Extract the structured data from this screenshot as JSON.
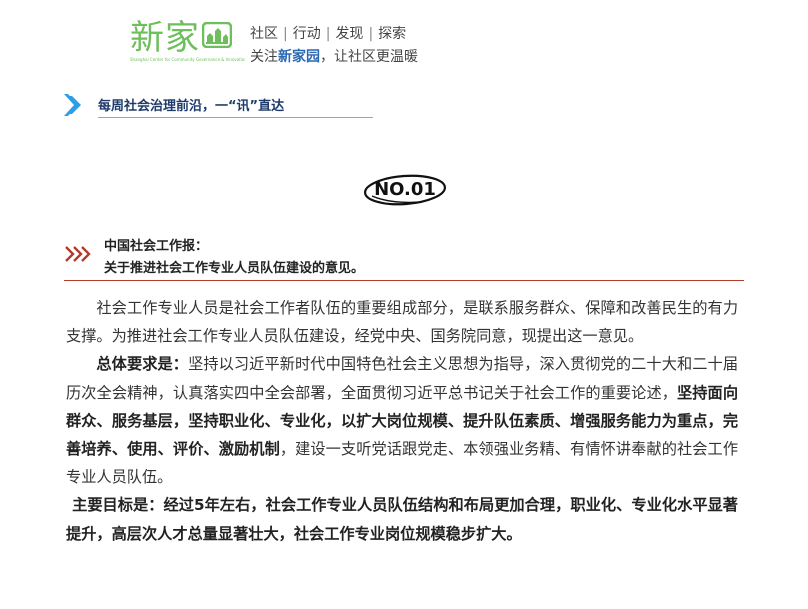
{
  "header": {
    "logo_text": "新家",
    "logo_subtext": "Shanghai Center for Community Governance & Innovation",
    "nav": [
      "社区",
      "行动",
      "发现",
      "探索"
    ],
    "tagline_pre": "关注",
    "tagline_brand": "新家园",
    "tagline_post": "，让社区更温暖"
  },
  "banner": {
    "text": "每周社会治理前沿，一“讯”直达"
  },
  "section": {
    "number": "NO.01",
    "title_line1": "中国社会工作报：",
    "title_line2": "关于推进社会工作专业人员队伍建设的意见。"
  },
  "body": {
    "p1": "社会工作专业人员是社会工作者队伍的重要组成部分，是联系服务群众、保障和改善民生的有力支撑。为推进社会工作专业人员队伍建设，经党中央、国务院同意，现提出这一意见。",
    "p2_label": "总体要求是：",
    "p2_text1": "坚持以习近平新时代中国特色社会主义思想为指导，深入贯彻党的二十大和二十届历次全会精神，认真落实四中全会部署，全面贯彻习近平总书记关于社会工作的重要论述，",
    "p2_bold": "坚持面向群众、服务基层，坚持职业化、专业化，以扩大岗位规模、提升队伍素质、增强服务能力为重点，完善培养、使用、评价、激励机制",
    "p2_text2": "，建设一支听党话跟党走、本领强业务精、有情怀讲奉献的社会工作专业人员队伍。",
    "p3": "主要目标是：经过5年左右，社会工作专业人员队伍结构和布局更加合理，职业化、专业化水平显著提升，高层次人才总量显著壮大，社会工作专业岗位规模稳步扩大。"
  },
  "colors": {
    "logo_green": "#6cbf5a",
    "brand_blue": "#2a68b5",
    "banner_blue": "#2f9ee8",
    "section_red": "#b23b2b"
  }
}
